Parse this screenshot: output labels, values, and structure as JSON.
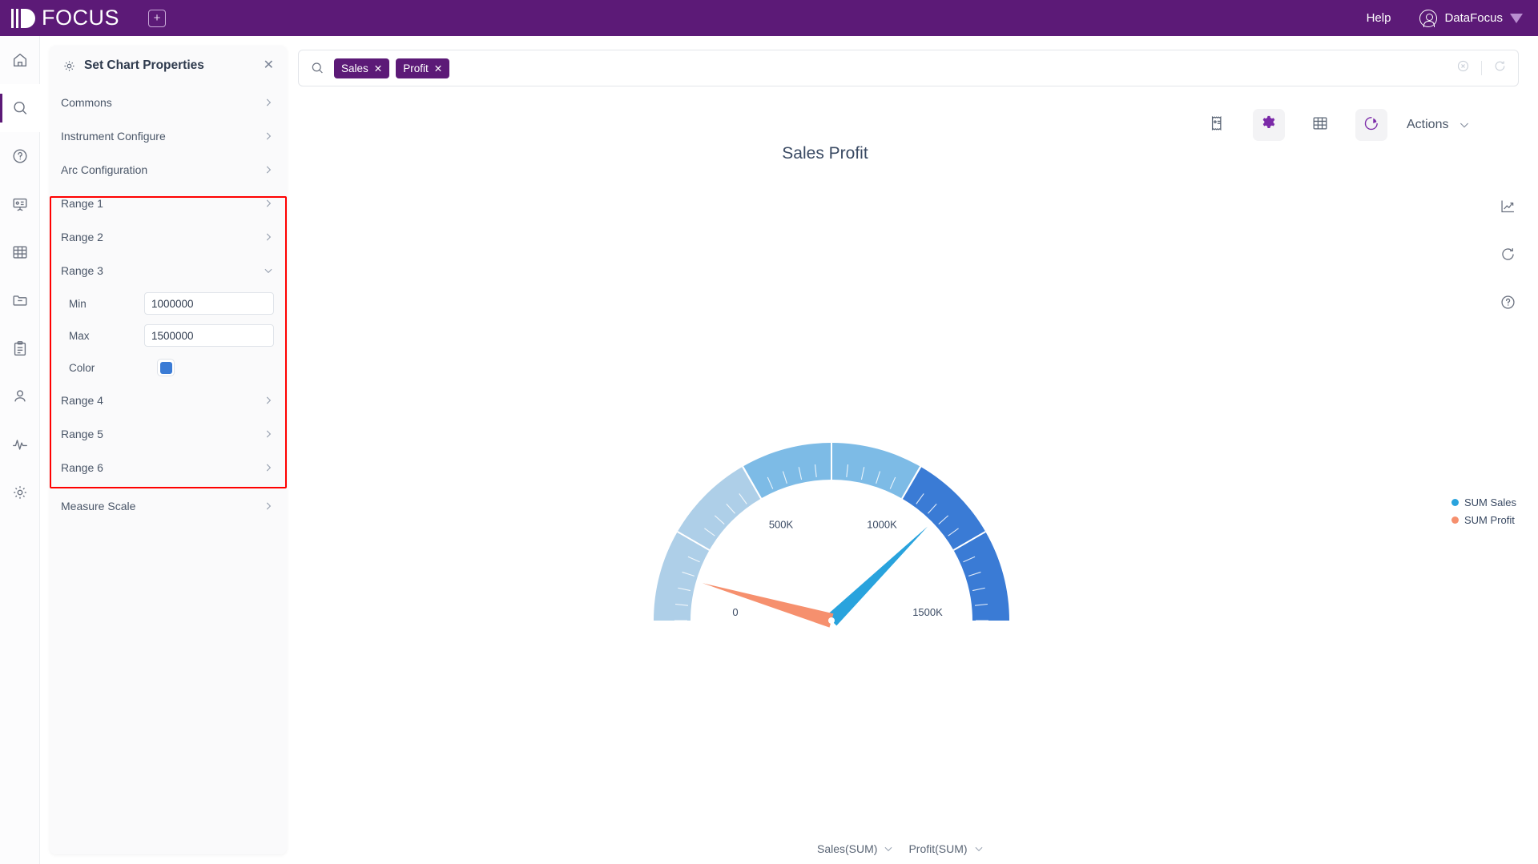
{
  "topbar": {
    "logo_text": "FOCUS",
    "add_tab_icon": "plus-square-icon",
    "help_label": "Help",
    "user_label": "DataFocus",
    "brand_color": "#5c1a77"
  },
  "rail": {
    "items": [
      {
        "name": "home-icon",
        "label": "Home",
        "active": false
      },
      {
        "name": "search-icon",
        "label": "Search",
        "active": true
      },
      {
        "name": "question-circle-icon",
        "label": "Help",
        "active": false
      },
      {
        "name": "presentation-icon",
        "label": "Dashboard",
        "active": false
      },
      {
        "name": "table-grid-icon",
        "label": "Data",
        "active": false
      },
      {
        "name": "folder-icon",
        "label": "Folder",
        "active": false
      },
      {
        "name": "clipboard-icon",
        "label": "Tasks",
        "active": false
      },
      {
        "name": "user-icon",
        "label": "Users",
        "active": false
      },
      {
        "name": "activity-icon",
        "label": "Monitor",
        "active": false
      },
      {
        "name": "gear-icon",
        "label": "Settings",
        "active": false
      }
    ]
  },
  "panel": {
    "title": "Set Chart Properties",
    "gear_icon": "gear-icon",
    "close_icon": "close-icon",
    "sections": [
      {
        "label": "Commons",
        "expanded": false
      },
      {
        "label": "Instrument Configure",
        "expanded": false
      },
      {
        "label": "Arc Configuration",
        "expanded": false
      },
      {
        "label": "Range 1",
        "expanded": false
      },
      {
        "label": "Range 2",
        "expanded": false
      },
      {
        "label": "Range 3",
        "expanded": true
      },
      {
        "label": "Range 4",
        "expanded": false
      },
      {
        "label": "Range 5",
        "expanded": false
      },
      {
        "label": "Range 6",
        "expanded": false
      },
      {
        "label": "Measure Scale",
        "expanded": false
      }
    ],
    "range3": {
      "min_label": "Min",
      "min_value": "1000000",
      "max_label": "Max",
      "max_value": "1500000",
      "color_label": "Color",
      "color_value": "#3a7bd5"
    },
    "highlight_color": "#ff0000"
  },
  "search": {
    "search_icon": "search-icon",
    "tokens": [
      {
        "label": "Sales",
        "remove_icon": "close-icon"
      },
      {
        "label": "Profit",
        "remove_icon": "close-icon"
      }
    ],
    "clear_icon": "clear-circle-icon",
    "refresh_icon": "refresh-icon"
  },
  "chart_toolbar": {
    "buttons": [
      {
        "name": "receipt-icon",
        "label": "Summary",
        "selected": false
      },
      {
        "name": "gear-icon",
        "label": "Chart Properties",
        "selected": true
      },
      {
        "name": "table-grid-icon",
        "label": "Table View",
        "selected": false
      },
      {
        "name": "pie-chart-icon",
        "label": "Chart View",
        "selected": true
      }
    ],
    "actions_label": "Actions",
    "actions_chevron": "chevron-down-icon"
  },
  "right_tools": [
    {
      "name": "trend-chart-icon",
      "label": "Trend"
    },
    {
      "name": "refresh-icon",
      "label": "Refresh"
    },
    {
      "name": "question-circle-icon",
      "label": "Help"
    }
  ],
  "footer_fields": [
    {
      "label": "Sales(SUM)",
      "chevron": "chevron-down-icon"
    },
    {
      "label": "Profit(SUM)",
      "chevron": "chevron-down-icon"
    }
  ],
  "chart_data": {
    "type": "gauge",
    "title": "Sales Profit",
    "min": 0,
    "max": 1500000,
    "tick_labels": [
      "0",
      "500K",
      "1000K",
      "1500K"
    ],
    "tick_values": [
      0,
      500000,
      1000000,
      1500000
    ],
    "bands": [
      {
        "name": "Range 1",
        "from": 0,
        "to": 500000,
        "color": "#aecfe8"
      },
      {
        "name": "Range 2",
        "from": 500000,
        "to": 1000000,
        "color": "#7dbbe6"
      },
      {
        "name": "Range 3",
        "from": 1000000,
        "to": 1500000,
        "color": "#3a7bd5"
      }
    ],
    "series": [
      {
        "name": "SUM Sales",
        "color": "#29a3dd",
        "value": 1130000
      },
      {
        "name": "SUM Profit",
        "color": "#f6906e",
        "value": 135000
      }
    ],
    "legend_position": "right",
    "legend": [
      "SUM Sales",
      "SUM Profit"
    ]
  }
}
